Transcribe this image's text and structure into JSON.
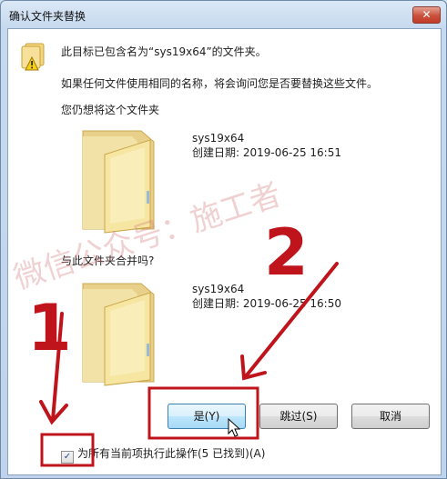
{
  "window": {
    "title": "确认文件夹替换",
    "close_label": "✕"
  },
  "message": {
    "line1": "此目标已包含名为“sys19x64”的文件夹。",
    "line2": "如果任何文件使用相同的名称，将会询问您是否要替换这些文件。",
    "line3": "您仍想将这个文件夹",
    "line4": "与此文件夹合并吗?"
  },
  "folders": [
    {
      "name": "sys19x64",
      "date": "创建日期: 2019-06-25 16:51"
    },
    {
      "name": "sys19x64",
      "date": "创建日期: 2019-06-25 16:50"
    }
  ],
  "buttons": {
    "yes": "是(Y)",
    "skip": "跳过(S)",
    "cancel": "取消"
  },
  "checkbox": {
    "checked": true,
    "label": "为所有当前项执行此操作(5 已找到)(A)"
  },
  "annotations": {
    "watermark": "微信公众号：施工者",
    "label_1": "1",
    "label_2": "2",
    "highlight_color": "#c0141c"
  },
  "icons": [
    "warning-folders-icon",
    "folder-icon",
    "mouse-cursor-icon"
  ]
}
